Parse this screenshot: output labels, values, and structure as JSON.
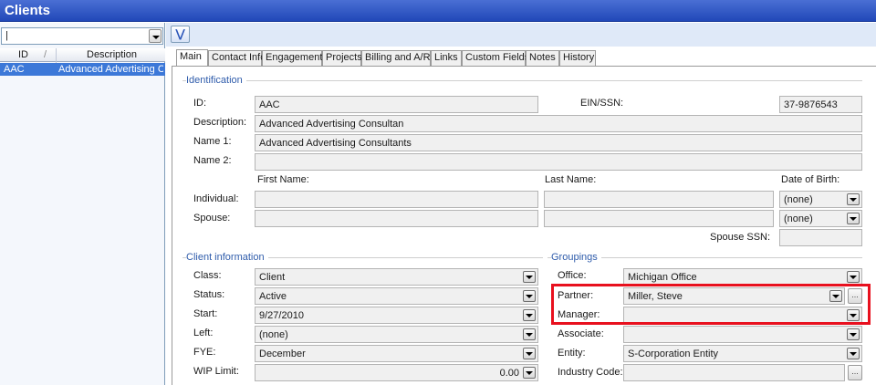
{
  "window": {
    "title": "Clients"
  },
  "client_list": {
    "search": {
      "value": "|"
    },
    "columns": {
      "id": "ID",
      "sort_indicator": "/",
      "description": "Description"
    },
    "rows": [
      {
        "id": "AAC",
        "description": "Advanced Advertising Co"
      }
    ]
  },
  "toolbar": {
    "collapse_icon": "double-chevron-down-icon"
  },
  "tabs": [
    "Main",
    "Contact Info",
    "Engagements",
    "Projects",
    "Billing and A/R",
    "Links",
    "Custom Fields",
    "Notes",
    "History"
  ],
  "identification": {
    "section": "Identification",
    "id_label": "ID:",
    "id_value": "AAC",
    "ein_label": "EIN/SSN:",
    "ein_value": "37-9876543",
    "desc_label": "Description:",
    "desc_value": "Advanced Advertising Consultan",
    "name1_label": "Name 1:",
    "name1_value": "Advanced Advertising Consultants",
    "name2_label": "Name 2:",
    "name2_value": "",
    "first_name_label": "First Name:",
    "last_name_label": "Last Name:",
    "dob_label": "Date of Birth:",
    "individual_label": "Individual:",
    "individual_dob": "(none)",
    "spouse_label": "Spouse:",
    "spouse_dob": "(none)",
    "spouse_ssn_label": "Spouse SSN:"
  },
  "client_info": {
    "section": "Client information",
    "class_label": "Class:",
    "class_value": "Client",
    "status_label": "Status:",
    "status_value": "Active",
    "start_label": "Start:",
    "start_value": "9/27/2010",
    "left_label": "Left:",
    "left_value": "(none)",
    "fye_label": "FYE:",
    "fye_value": "December",
    "wip_label": "WIP Limit:",
    "wip_value": "0.00"
  },
  "groupings": {
    "section": "Groupings",
    "office_label": "Office:",
    "office_value": "Michigan Office",
    "partner_label": "Partner:",
    "partner_value": "Miller, Steve",
    "manager_label": "Manager:",
    "manager_value": "",
    "associate_label": "Associate:",
    "associate_value": "",
    "entity_label": "Entity:",
    "entity_value": "S-Corporation Entity",
    "industry_label": "Industry Code:",
    "industry_value": ""
  },
  "colors": {
    "accent": "#2148b8",
    "highlight": "#e8101e",
    "selection": "#3c78d8"
  }
}
